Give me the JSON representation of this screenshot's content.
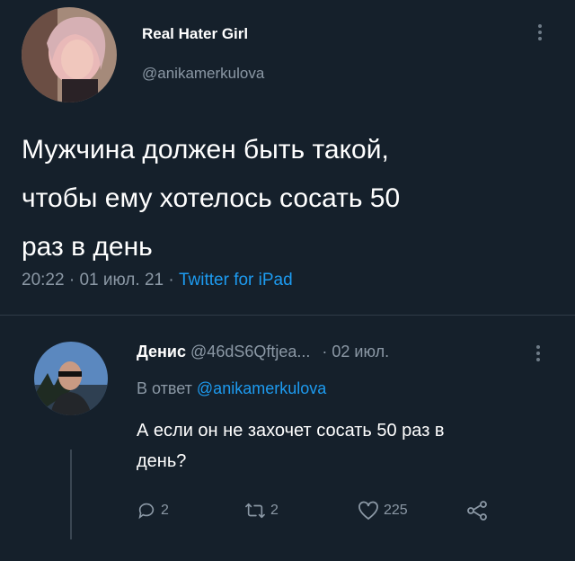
{
  "tweet": {
    "display_name": "Real Hater Girl",
    "handle": "@anikamerkulova",
    "text_lines": [
      "Мужчина должен быть такой,",
      "чтобы ему хотелось сосать 50",
      "раз в день"
    ],
    "time": "20:22",
    "date": "01 июл. 21",
    "separator": "·",
    "source": "Twitter for iPad"
  },
  "reply": {
    "display_name": "Денис",
    "handle": "@46dS6Qftjea...",
    "date": "· 02 июл.",
    "in_reply_prefix": "В ответ",
    "in_reply_handle": "@anikamerkulova",
    "text_lines": [
      "А если он не захочет сосать 50 раз в",
      "день?"
    ],
    "reply_count": "2",
    "retweet_count": "2",
    "like_count": "225"
  },
  "icons": {
    "more": "more-icon",
    "reply": "reply-icon",
    "retweet": "retweet-icon",
    "like": "heart-icon",
    "share": "share-icon"
  },
  "colors": {
    "background": "#15202b",
    "accent": "#1d9bf0",
    "muted": "#8b98a5"
  }
}
